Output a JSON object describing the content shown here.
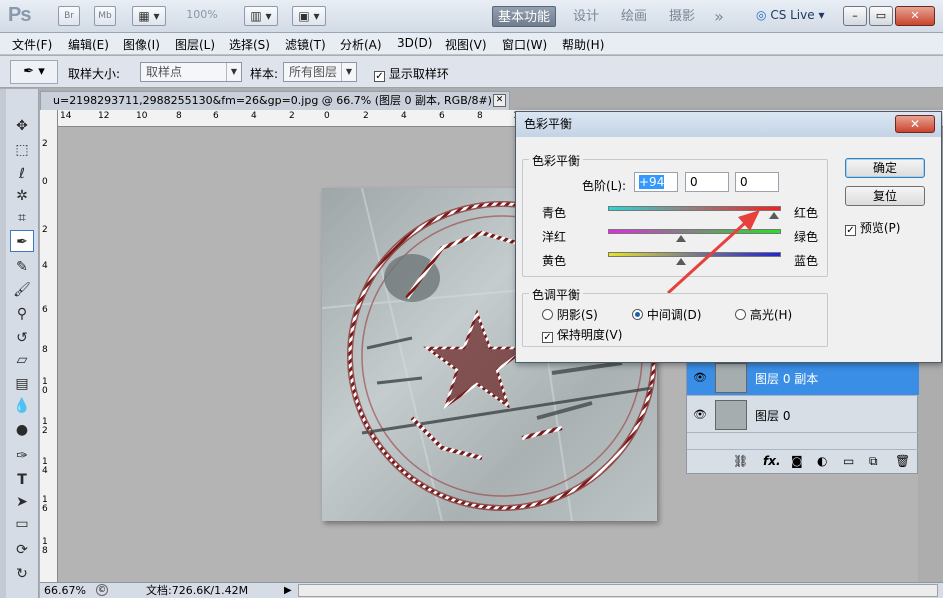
{
  "app": {
    "logo": "Ps",
    "toolbar_btns": [
      "Br",
      "Mb"
    ],
    "zoom": "100%",
    "workspaces": [
      "基本功能",
      "设计",
      "绘画",
      "摄影"
    ],
    "more": "»",
    "cslive": "CS Live"
  },
  "menu": [
    "文件(F)",
    "编辑(E)",
    "图像(I)",
    "图层(L)",
    "选择(S)",
    "滤镜(T)",
    "分析(A)",
    "3D(D)",
    "视图(V)",
    "窗口(W)",
    "帮助(H)"
  ],
  "options": {
    "sample_size_label": "取样大小:",
    "sample_size_value": "取样点",
    "sample_label": "样本:",
    "sample_value": "所有图层",
    "show_ring_label": "显示取样环"
  },
  "document": {
    "tab_title": "u=2198293711,2988255130&fm=26&gp=0.jpg @ 66.7% (图层 0 副本, RGB/8#) *",
    "ruler_top": [
      "14",
      "12",
      "10",
      "8",
      "6",
      "4",
      "2",
      "0",
      "2",
      "4",
      "6",
      "8",
      "10"
    ],
    "ruler_left": [
      "2",
      "0",
      "2",
      "4",
      "6",
      "8",
      "10",
      "12",
      "14",
      "16",
      "18"
    ]
  },
  "status": {
    "zoom": "66.67%",
    "doc_info": "文档:726.6K/1.42M"
  },
  "layers": {
    "items": [
      {
        "name": "图层 0 副本",
        "selected": true
      },
      {
        "name": "图层 0",
        "selected": false
      }
    ],
    "footer_fx": "fx."
  },
  "dialog": {
    "title": "色彩平衡",
    "close": "✕",
    "balance_group": "色彩平衡",
    "levels_label": "色阶(L):",
    "levels": [
      "+94",
      "0",
      "0"
    ],
    "sliders": [
      {
        "left": "青色",
        "right": "红色",
        "value": 94
      },
      {
        "left": "洋红",
        "right": "绿色",
        "value": 0
      },
      {
        "left": "黄色",
        "right": "蓝色",
        "value": 0
      }
    ],
    "tone_group": "色调平衡",
    "tones": [
      "阴影(S)",
      "中间调(D)",
      "高光(H)"
    ],
    "selected_tone": "中间调(D)",
    "preserve_luminosity": "保持明度(V)",
    "ok": "确定",
    "reset": "复位",
    "preview": "预览(P)"
  }
}
